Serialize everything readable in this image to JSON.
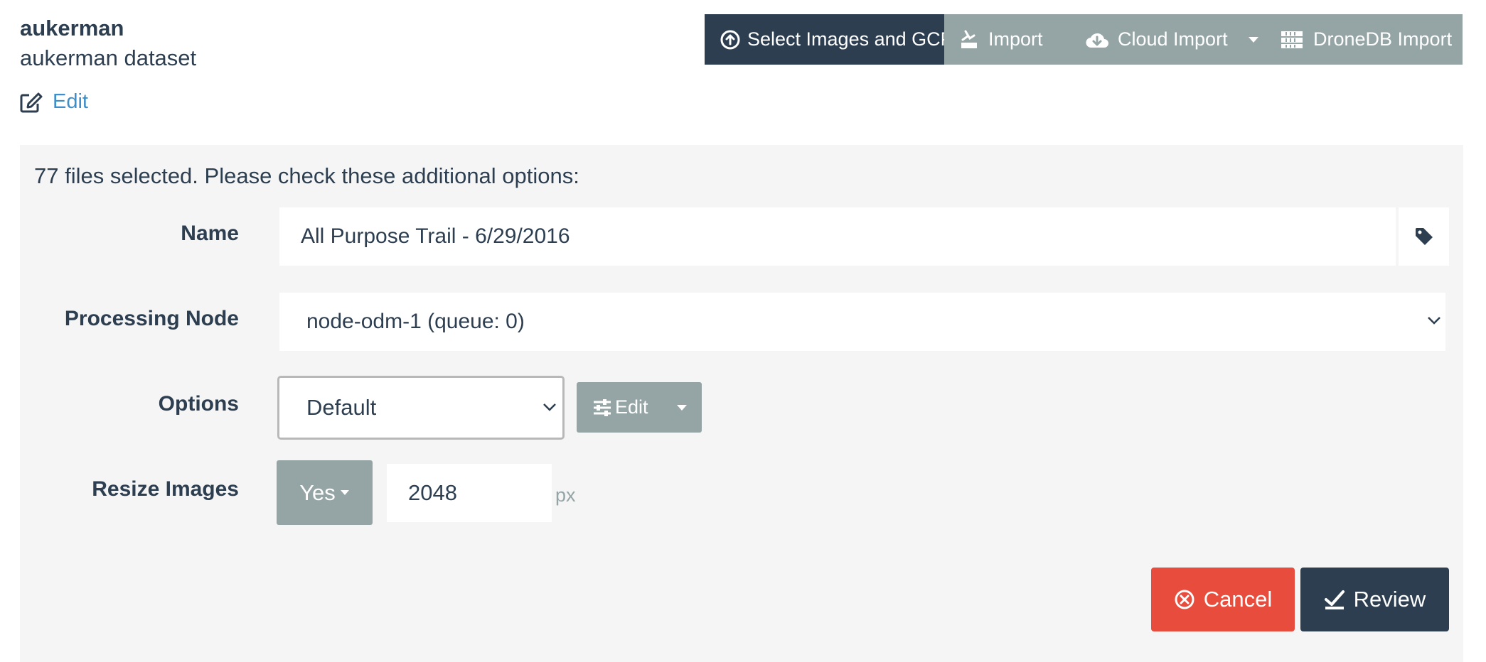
{
  "project": {
    "name": "aukerman",
    "description": "aukerman dataset",
    "edit_label": "Edit"
  },
  "toolbar": {
    "select_images_label": "Select Images and GCP",
    "import_label": "Import",
    "cloud_import_label": "Cloud Import",
    "dronedb_import_label": "DroneDB Import"
  },
  "form": {
    "message": "77 files selected. Please check these additional options:",
    "name_label": "Name",
    "name_value": "All Purpose Trail - 6/29/2016",
    "processing_node_label": "Processing Node",
    "processing_node_value": "node-odm-1 (queue: 0)",
    "options_label": "Options",
    "options_value": "Default",
    "options_edit_label": "Edit",
    "resize_label": "Resize Images",
    "resize_toggle_value": "Yes",
    "resize_value": "2048",
    "resize_unit": "px",
    "cancel_label": "Cancel",
    "review_label": "Review"
  },
  "icons": {
    "select_images": "arrow-circle-up-icon",
    "import": "import-icon",
    "cloud_import": "cloud-download-icon",
    "dronedb": "server-icon",
    "edit": "edit-icon",
    "tag": "tag-icon",
    "options_edit": "sliders-icon",
    "cancel": "times-circle-icon",
    "review": "check-review-icon"
  },
  "colors": {
    "primary_dark": "#2c3e50",
    "gray_button": "#95a5a6",
    "link_blue": "#3d8ec9",
    "cancel_red": "#e74c3c",
    "panel_bg": "#f5f5f5"
  }
}
